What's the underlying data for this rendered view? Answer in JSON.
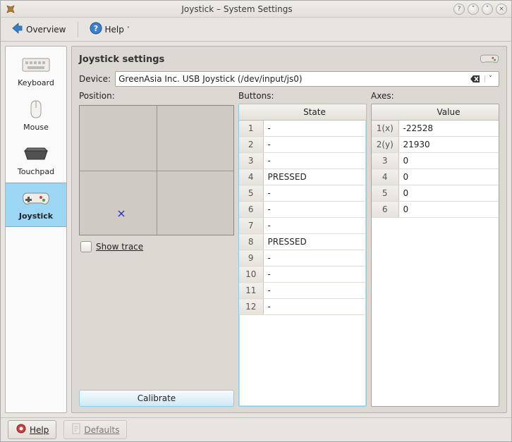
{
  "window_title": "Joystick – System Settings",
  "toolbar": {
    "overview_label": "Overview",
    "help_label": "Help"
  },
  "sidebar": {
    "items": [
      {
        "label": "Keyboard",
        "icon": "keyboard-icon"
      },
      {
        "label": "Mouse",
        "icon": "mouse-icon"
      },
      {
        "label": "Touchpad",
        "icon": "touchpad-icon"
      },
      {
        "label": "Joystick",
        "icon": "gamepad-icon"
      }
    ]
  },
  "main": {
    "heading": "Joystick settings",
    "device_label": "Device:",
    "device_value": "GreenAsia Inc.    USB  Joystick  (/dev/input/js0)",
    "position_label": "Position:",
    "buttons_label": "Buttons:",
    "axes_label": "Axes:",
    "state_header": "State",
    "value_header": "Value",
    "show_trace_label": "Show trace",
    "calibrate_label": "Calibrate",
    "cross_position": {
      "left_pct": 27,
      "top_pct": 83
    },
    "buttons": [
      {
        "row": "1",
        "state": "-"
      },
      {
        "row": "2",
        "state": "-"
      },
      {
        "row": "3",
        "state": "-"
      },
      {
        "row": "4",
        "state": "PRESSED"
      },
      {
        "row": "5",
        "state": "-"
      },
      {
        "row": "6",
        "state": "-"
      },
      {
        "row": "7",
        "state": "-"
      },
      {
        "row": "8",
        "state": "PRESSED"
      },
      {
        "row": "9",
        "state": "-"
      },
      {
        "row": "10",
        "state": "-"
      },
      {
        "row": "11",
        "state": "-"
      },
      {
        "row": "12",
        "state": "-"
      }
    ],
    "axes": [
      {
        "row": "1(x)",
        "value": "-22528"
      },
      {
        "row": "2(y)",
        "value": "21930"
      },
      {
        "row": "3",
        "value": "0"
      },
      {
        "row": "4",
        "value": "0"
      },
      {
        "row": "5",
        "value": "0"
      },
      {
        "row": "6",
        "value": "0"
      }
    ]
  },
  "footer": {
    "help_label": "Help",
    "defaults_label": "Defaults"
  }
}
